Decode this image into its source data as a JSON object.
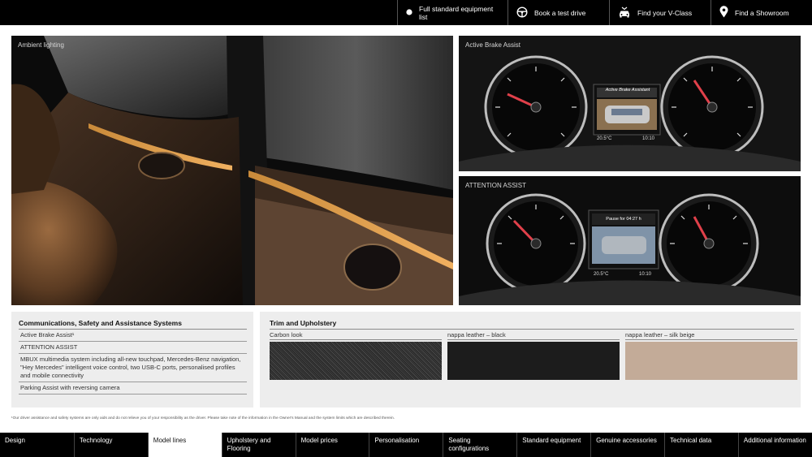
{
  "header": {
    "links": [
      {
        "label": "Full standard equipment list",
        "icon": "circle-icon"
      },
      {
        "label": "Book a test drive",
        "icon": "steering-wheel-icon"
      },
      {
        "label": "Find your V-Class",
        "icon": "car-icon"
      },
      {
        "label": "Find a Showroom",
        "icon": "location-pin-icon"
      }
    ]
  },
  "images": {
    "ambient": {
      "caption": "Ambient lighting"
    },
    "brake": {
      "caption": "Active Brake Assist",
      "screen_text": "Active Brake Assistant",
      "temp": "20.5°C",
      "time": "10:10"
    },
    "attention": {
      "caption": "ATTENTION ASSIST",
      "screen_text": "Pause for 04:27 h",
      "temp": "20.5°C",
      "time": "10:10"
    }
  },
  "communications": {
    "title": "Communications, Safety and Assistance Systems",
    "items": [
      "Active Brake Assist¹",
      "ATTENTION ASSIST",
      "MBUX multimedia system including all-new touchpad, Mercedes-Benz navigation, \"Hey Mercedes\" intelligent voice control, two USB-C ports, personalised profiles and mobile connectivity",
      "Parking Assist with reversing camera"
    ]
  },
  "trim": {
    "title": "Trim and Upholstery",
    "options": [
      {
        "label": "Carbon look",
        "color": "#2e2e2e"
      },
      {
        "label": "nappa leather – black",
        "color": "#1c1c1c"
      },
      {
        "label": "nappa leather – silk beige",
        "color": "#c3ab98"
      }
    ]
  },
  "footnote": "¹Our driver assistance and safety systems are only aids and do not relieve you of your responsibility as the driver. Please take note of the information in the Owner's Manual and the system limits which are described therein.",
  "bottom_nav": {
    "items": [
      "Design",
      "Technology",
      "Model lines",
      "Upholstery and Flooring",
      "Model prices",
      "Personalisation",
      "Seating configurations",
      "Standard equipment",
      "Genuine accessories",
      "Technical data",
      "Additional information"
    ],
    "active": "Model lines"
  }
}
